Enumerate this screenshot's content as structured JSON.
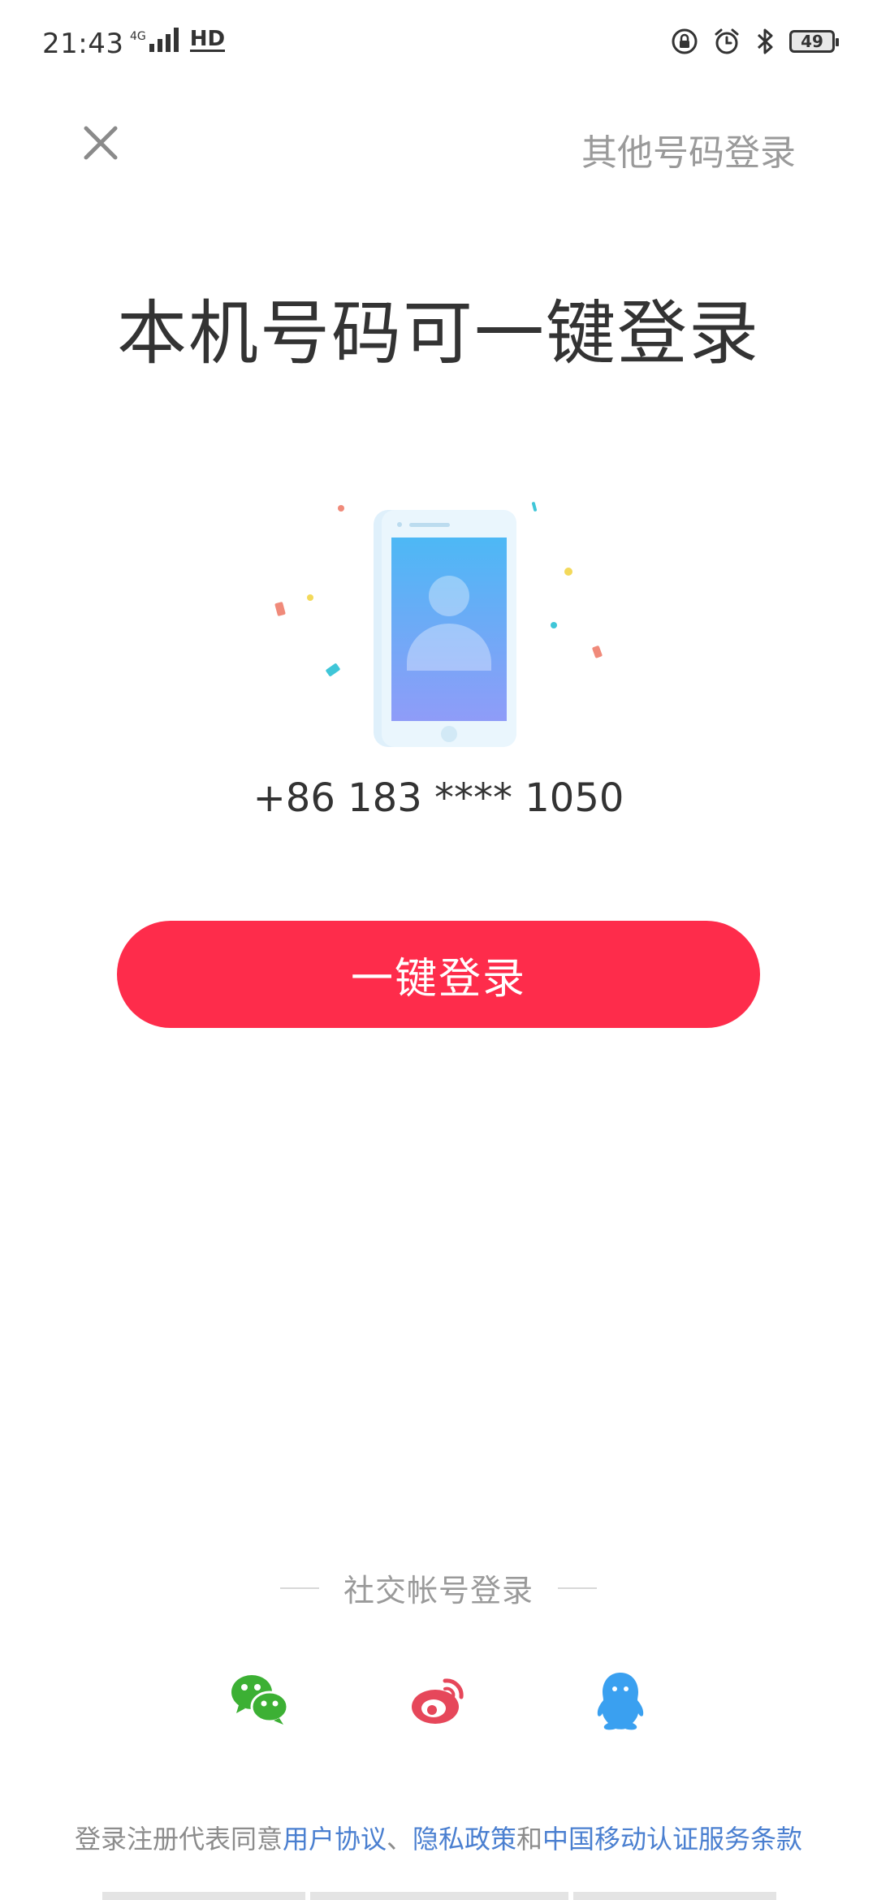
{
  "status_bar": {
    "time": "21:43",
    "network": "4G",
    "hd": "HD",
    "battery": "49"
  },
  "header": {
    "other_login_label": "其他号码登录"
  },
  "title": "本机号码可一键登录",
  "phone_number": "+86 183 **** 1050",
  "login_button_label": "一键登录",
  "social": {
    "divider_label": "社交帐号登录",
    "providers": [
      "wechat-icon",
      "weibo-icon",
      "qq-icon"
    ]
  },
  "agreement": {
    "prefix": "登录注册代表同意",
    "user_agreement": "用户协议",
    "sep1": "、",
    "privacy_policy": "隐私政策",
    "sep2": "和",
    "cmcc_terms": "中国移动认证服务条款"
  },
  "colors": {
    "accent": "#fe2c4b",
    "link": "#4a7fd0",
    "muted": "#9a9a9a",
    "wechat": "#3cb034",
    "weibo": "#e6475a",
    "qq": "#3aa0f0"
  }
}
